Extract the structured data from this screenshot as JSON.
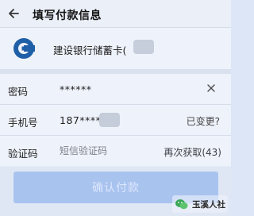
{
  "header": {
    "title": "填写付款信息",
    "back_icon": "back-arrow-icon"
  },
  "bank": {
    "name": "建设银行储蓄卡(",
    "logo_icon": "ccb-bank-logo",
    "logo_color": "#1f5fa8"
  },
  "form": {
    "password": {
      "label": "密码",
      "value": "******",
      "clear_icon": "clear-x-icon"
    },
    "phone": {
      "label": "手机号",
      "value": "187****",
      "changed_link": "已变更?"
    },
    "code": {
      "label": "验证码",
      "placeholder": "短信验证码",
      "resend_label": "再次获取(43)"
    }
  },
  "actions": {
    "confirm_label": "确认付款",
    "confirm_color": "#a9c3ef"
  },
  "watermark": {
    "text": "玉溪人社"
  }
}
